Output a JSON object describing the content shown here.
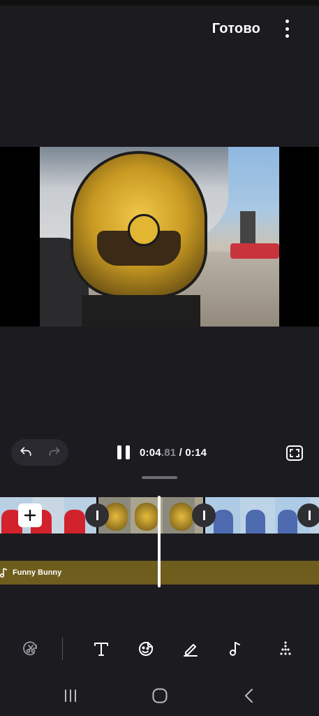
{
  "topbar": {
    "done_label": "Готово",
    "more_icon": "more-vert-icon"
  },
  "player": {
    "current_whole": "0:04",
    "current_fraction": ".81",
    "separator": " / ",
    "duration": "0:14",
    "pause_icon": "pause-icon",
    "fullscreen_icon": "fullscreen-icon"
  },
  "history": {
    "undo_icon": "undo-icon",
    "redo_icon": "redo-icon"
  },
  "timeline": {
    "clips": [
      {
        "name": "clip-people",
        "icon": "add-icon"
      },
      {
        "name": "clip-helmet"
      },
      {
        "name": "clip-riders"
      }
    ],
    "transition_icon": "transition-icon",
    "audio_track_label": "Funny Bunny"
  },
  "toolbar": {
    "tools": [
      "trim-icon",
      "text-icon",
      "sticker-icon",
      "draw-icon",
      "audio-icon",
      "more-tools-icon"
    ]
  },
  "navigation": {
    "items": [
      "recents-icon",
      "home-icon",
      "back-icon"
    ]
  },
  "colors": {
    "background": "#1c1b20",
    "audio_track": "#6e5d1c",
    "accent": "#ffffff"
  }
}
